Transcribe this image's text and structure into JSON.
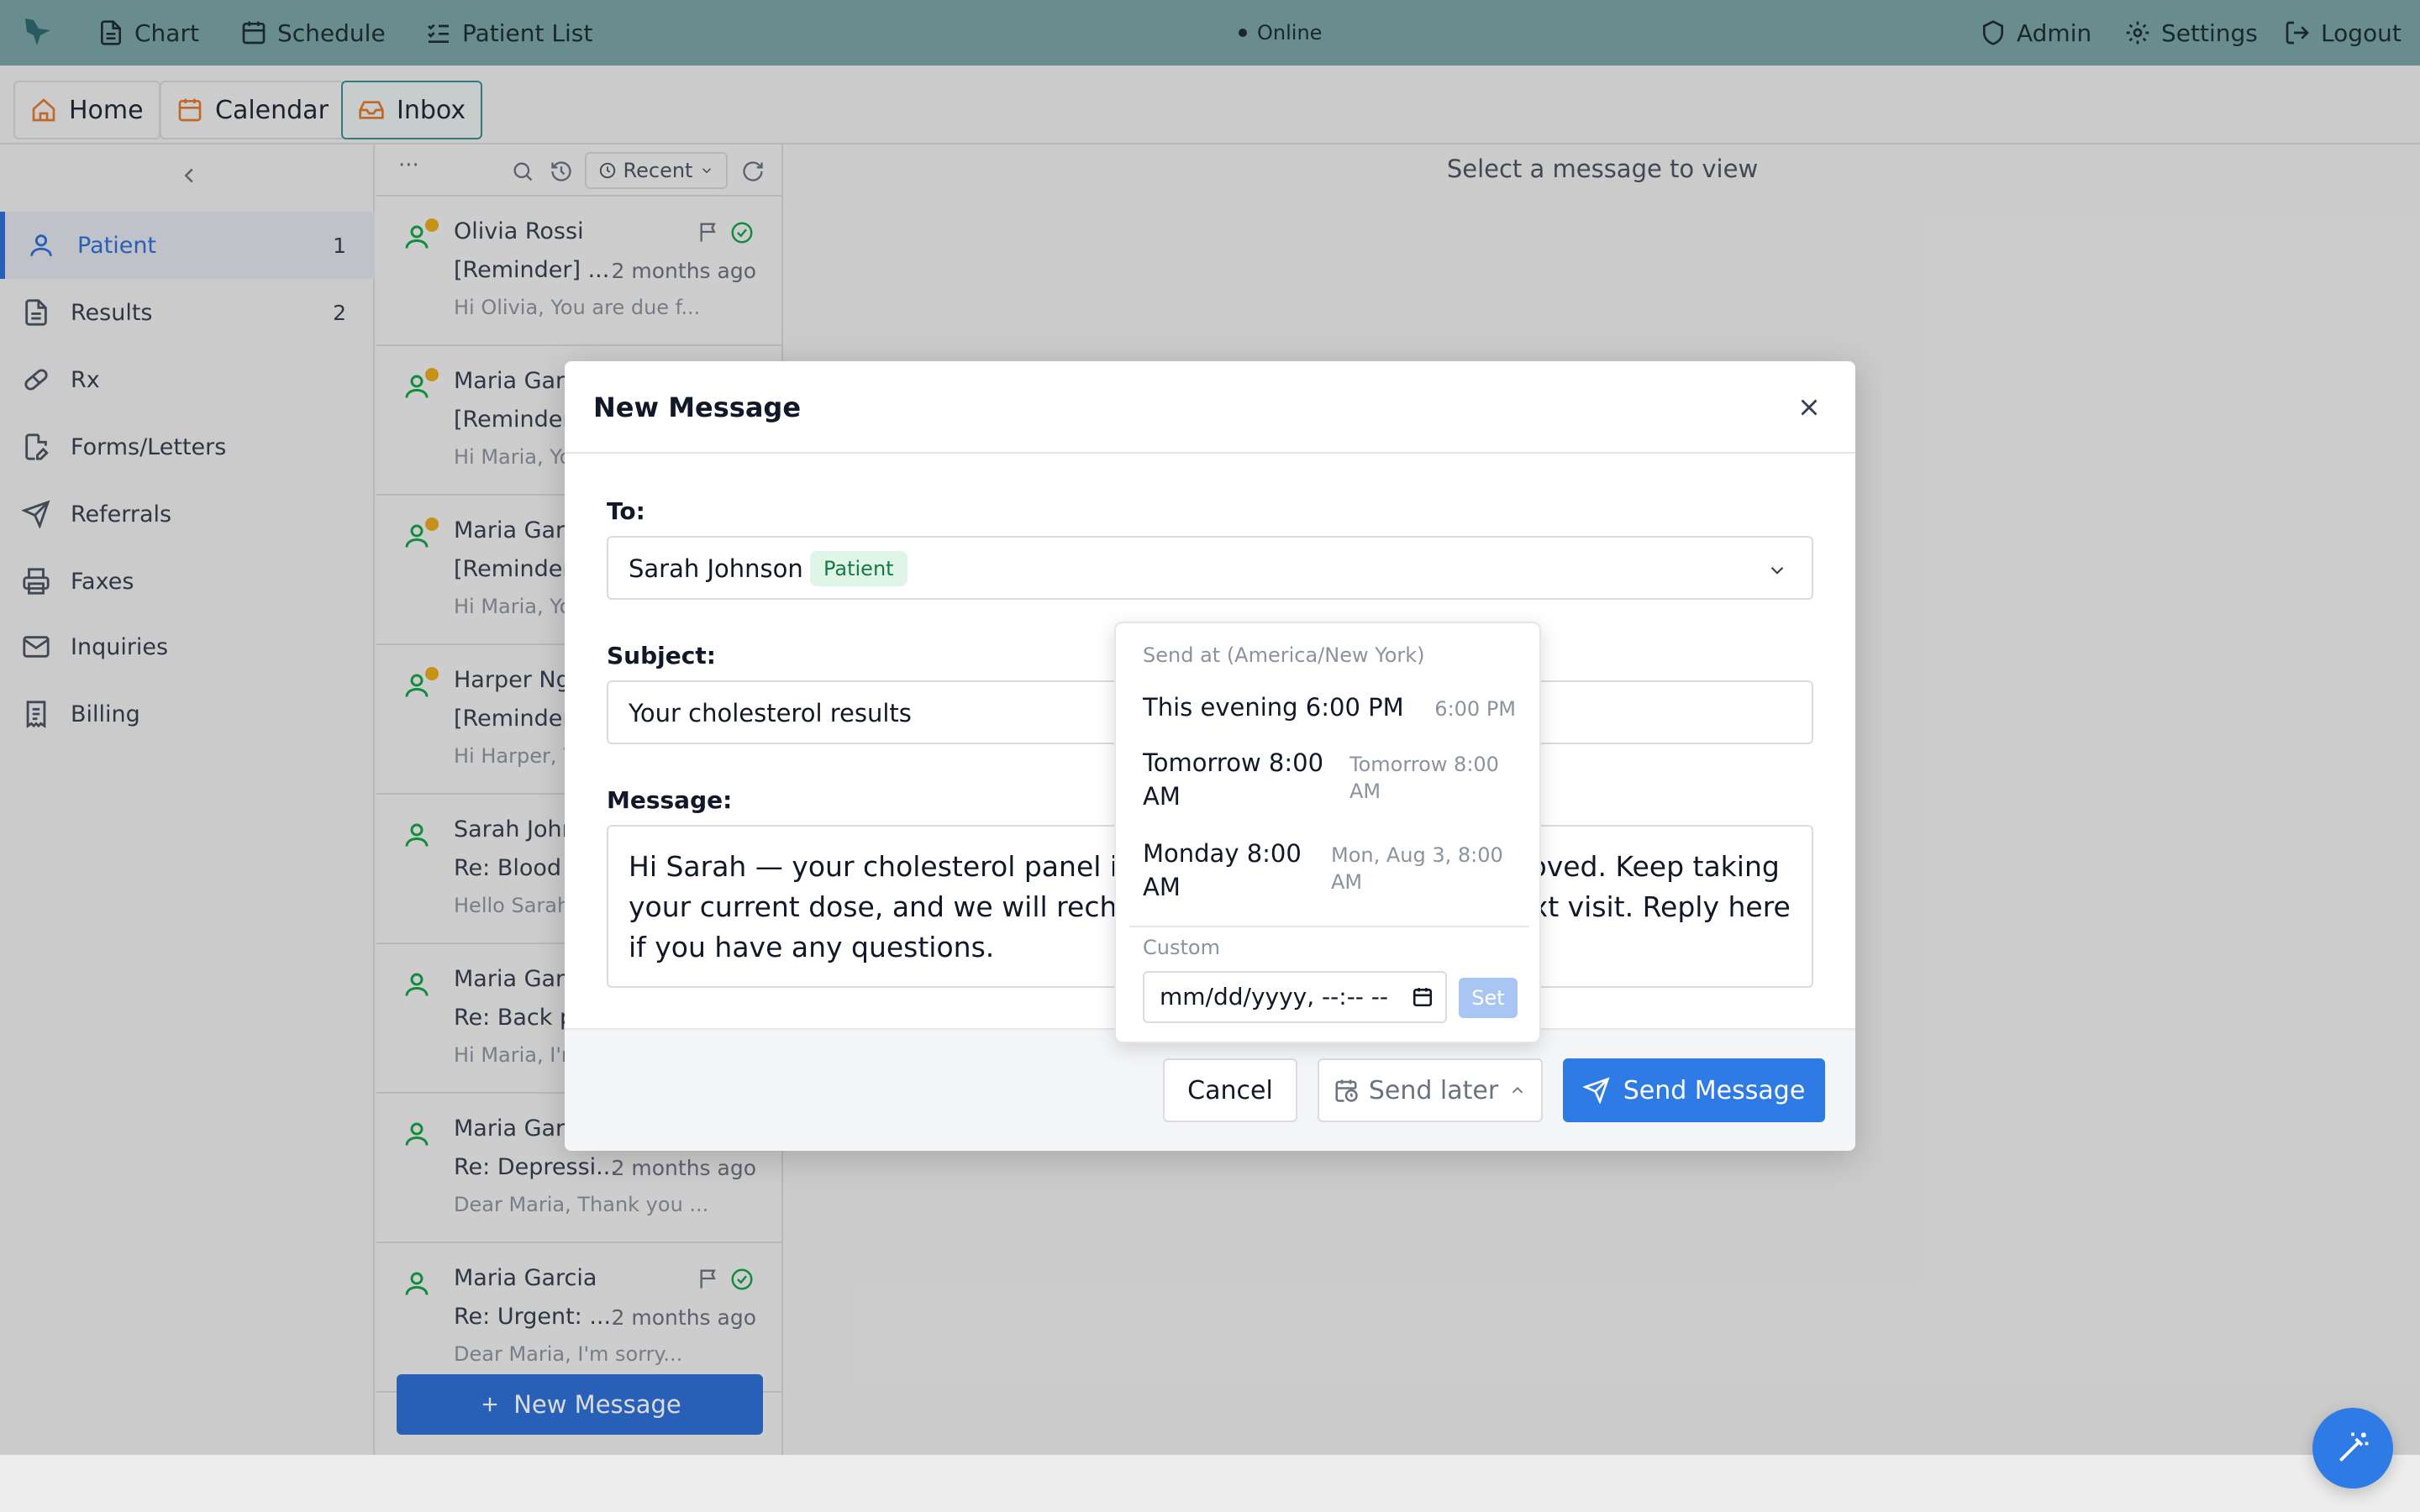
{
  "topnav": {
    "items": [
      {
        "label": "Chart",
        "icon": "document-icon"
      },
      {
        "label": "Schedule",
        "icon": "calendar-icon"
      },
      {
        "label": "Patient List",
        "icon": "list-check-icon"
      }
    ],
    "status": "Online",
    "right_items": [
      {
        "label": "Admin",
        "icon": "shield-icon"
      },
      {
        "label": "Settings",
        "icon": "gear-icon"
      },
      {
        "label": "Logout",
        "icon": "logout-icon"
      }
    ]
  },
  "tabs": [
    {
      "label": "Home",
      "icon": "home-icon",
      "active": false
    },
    {
      "label": "Calendar",
      "icon": "calendar-icon",
      "active": false
    },
    {
      "label": "Inbox",
      "icon": "inbox-icon",
      "active": true
    }
  ],
  "sidebar": {
    "items": [
      {
        "label": "Patient",
        "count": "1",
        "icon": "person-icon",
        "active": true
      },
      {
        "label": "Results",
        "count": "2",
        "icon": "document-icon",
        "active": false
      },
      {
        "label": "Rx",
        "count": "",
        "icon": "pill-icon",
        "active": false
      },
      {
        "label": "Forms/Letters",
        "count": "",
        "icon": "form-edit-icon",
        "active": false
      },
      {
        "label": "Referrals",
        "count": "",
        "icon": "send-icon",
        "active": false
      },
      {
        "label": "Faxes",
        "count": "",
        "icon": "printer-icon",
        "active": false
      },
      {
        "label": "Inquiries",
        "count": "",
        "icon": "mail-icon",
        "active": false
      },
      {
        "label": "Billing",
        "count": "",
        "icon": "receipt-icon",
        "active": false
      }
    ]
  },
  "list": {
    "more": "···",
    "sort_label": "Recent",
    "messages": [
      {
        "name": "Olivia Rossi",
        "subject": "[Reminder] ...",
        "time": "2 months ago",
        "preview": "Hi Olivia, You are due f...",
        "unread": true
      },
      {
        "name": "Maria Garcia",
        "subject": "[Reminder] ...",
        "time": "",
        "preview": "Hi Maria, You",
        "unread": true
      },
      {
        "name": "Maria Garcia",
        "subject": "[Reminder] ...",
        "time": "",
        "preview": "Hi Maria, You",
        "unread": true
      },
      {
        "name": "Harper Nguyen",
        "subject": "[Reminder] ...",
        "time": "",
        "preview": "Hi Harper, You",
        "unread": true
      },
      {
        "name": "Sarah Johnson",
        "subject": "Re: Blood pressure",
        "time": "",
        "preview": "Hello Sarah,",
        "unread": false
      },
      {
        "name": "Maria Garcia",
        "subject": "Re: Back pain",
        "time": "",
        "preview": "Hi Maria, I'm",
        "unread": false
      },
      {
        "name": "Maria Garcia",
        "subject": "Re: Depressi...",
        "time": "2 months ago",
        "preview": "Dear Maria, Thank you ...",
        "unread": false
      },
      {
        "name": "Maria Garcia",
        "subject": "Re: Urgent: ...",
        "time": "2 months ago",
        "preview": "Dear Maria, I'm sorry...",
        "unread": false
      }
    ],
    "new_message_label": "New Message"
  },
  "detail": {
    "placeholder": "Select a message to view"
  },
  "modal": {
    "title": "New Message",
    "to_label": "To:",
    "to_name": "Sarah Johnson",
    "to_badge": "Patient",
    "subject_label": "Subject:",
    "subject_value": "Your cholesterol results",
    "message_label": "Message:",
    "message_value": "Hi Sarah — your cholesterol panel is back and your LDL has improved. Keep taking your current dose, and we will recheck a fasting panel at your next visit. Reply here if you have any questions.",
    "cancel_label": "Cancel",
    "send_later_label": "Send later",
    "send_label": "Send Message"
  },
  "send_later": {
    "header": "Send at (America/New York)",
    "options": [
      {
        "label": "This evening 6:00 PM",
        "detail": "6:00 PM"
      },
      {
        "label": "Tomorrow 8:00 AM",
        "detail": "Tomorrow 8:00 AM"
      },
      {
        "label": "Monday 8:00 AM",
        "detail": "Mon, Aug 3, 8:00 AM"
      }
    ],
    "custom_label": "Custom",
    "custom_placeholder": "mm/dd/yyyy, --:-- --",
    "set_label": "Set"
  },
  "colors": {
    "topbar": "#7ba3a7",
    "accent": "#2f7be6",
    "active_tab_border": "#3e8d92",
    "unread_dot": "#e6a91c",
    "patient_green": "#16a34a"
  }
}
